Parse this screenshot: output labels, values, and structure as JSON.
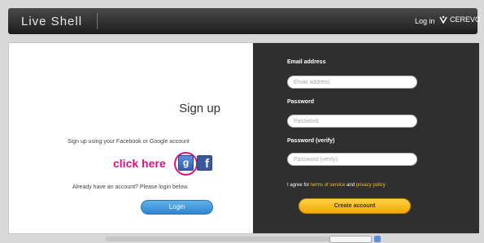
{
  "header": {
    "brand": "Live Shell",
    "login_link": "Log in",
    "company": "CEREVO"
  },
  "signup": {
    "title": "Sign up",
    "social_note": "Sign up using your Facebook or Google account",
    "click_hint": "click here",
    "google_glyph": "g",
    "facebook_glyph": "f",
    "already_note": "Already have an account? Please login below.",
    "login_button": "Login"
  },
  "form": {
    "email_label": "Email address",
    "email_placeholder": "Email address",
    "password_label": "Password",
    "password_placeholder": "Password",
    "password_verify_label": "Password (verify)",
    "password_verify_placeholder": "Password (verify)",
    "terms_prefix": "I agree for",
    "terms_link": "terms of service",
    "terms_and": "and",
    "privacy_link": "privacy policy",
    "create_button": "Create account"
  },
  "colors": {
    "accent_pink": "#e0117f",
    "login_blue": "#2f86cf",
    "create_yellow": "#f0a800",
    "dark_panel": "#2f2f2f"
  },
  "icons": {
    "google": "google-plus-icon",
    "facebook": "facebook-icon",
    "company_logo": "cerevo-logo-icon"
  }
}
